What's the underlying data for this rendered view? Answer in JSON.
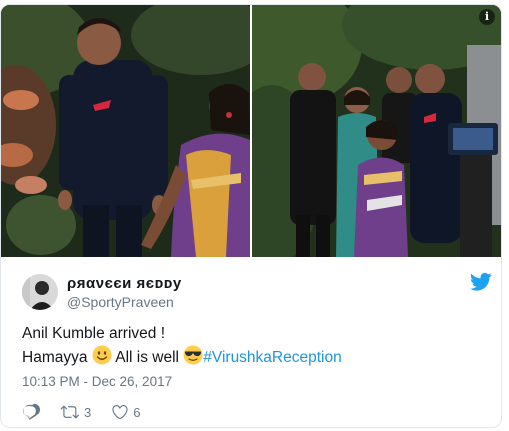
{
  "tweet": {
    "display_name": "ρяανєєи яєᴅᴅу",
    "handle": "@SportyPraveen",
    "text_line1": "Anil Kumble arrived !",
    "text_line2_a": "Hamayya",
    "text_line2_b": "All is well",
    "hashtag": "#VirushkaReception",
    "timestamp": "10:13 PM - Dec 26, 2017",
    "retweets": "3",
    "likes": "6"
  },
  "icons": {
    "brand": "twitter-bird-icon",
    "info": "info-icon",
    "reply": "reply-icon",
    "retweet": "retweet-icon",
    "like": "heart-icon",
    "emoji1": "slightly-smiling-face",
    "emoji2": "smiling-face-with-sunglasses"
  },
  "colors": {
    "link": "#1b95e0",
    "muted": "#657786",
    "text": "#14171a",
    "border": "#e1e8ed"
  }
}
